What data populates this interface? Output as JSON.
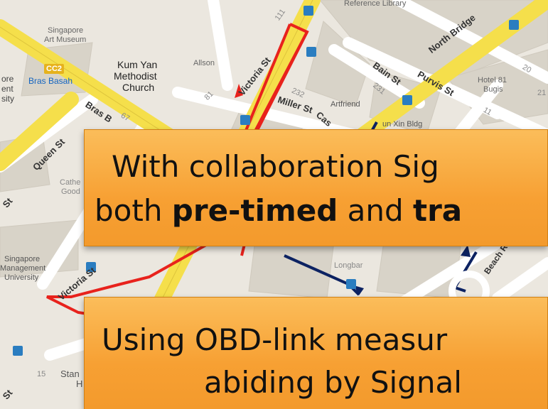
{
  "map": {
    "places": {
      "reference_library": "Reference Library",
      "art_museum_1": "Singapore",
      "art_museum_2": "Art Museum",
      "kum_yan_1": "Kum Yan",
      "kum_yan_2": "Methodist",
      "kum_yan_3": "Church",
      "allson": "Allson",
      "station_code": "CC2",
      "bras_basah": "Bras Basah",
      "left_1": "ore",
      "left_2": "ent",
      "left_3": "sity",
      "artfriend": "Artfriend",
      "hotel_1": "Hotel 81",
      "hotel_2": "Bugis",
      "xin_bldg": "un Xin Bldg",
      "cathe_1": "Cathe",
      "cathe_2": "Good",
      "smu_1": "Singapore",
      "smu_2": "Management",
      "smu_3": "University",
      "longbar": "Longbar",
      "stan": "Stan",
      "stan_h": "H"
    },
    "roads": {
      "victoria_upper": "Victoria St",
      "victoria_lower": "Victoria St",
      "north_bridge": "North Bridge",
      "bain": "Bain St",
      "purvis": "Purvis St",
      "bras_b": "Bras B",
      "miller": "Miller St",
      "cas": "Cas",
      "queen": "Queen St",
      "st_left": "St",
      "st_bottom": "St",
      "beach_rd": "Beach Rd"
    },
    "numbers": {
      "n111": "111",
      "n231": "231",
      "n232": "232",
      "n81": "81",
      "n67": "67",
      "n20": "20",
      "n21": "21",
      "n15": "15",
      "n11": "11"
    }
  },
  "callouts": {
    "top": {
      "pre": "With collaboration Sig",
      "line2_a": "both ",
      "line2_b": "pre-timed",
      "line2_c": " and ",
      "line2_d": "tra"
    },
    "bottom": {
      "line1": "Using OBD-link measur",
      "line2": "abiding by Signal"
    }
  },
  "colors": {
    "route_red": "#e8221c",
    "route_navy": "#0c2262",
    "road_yellow": "#f5df4b",
    "callout_orange": "#f7a033"
  }
}
